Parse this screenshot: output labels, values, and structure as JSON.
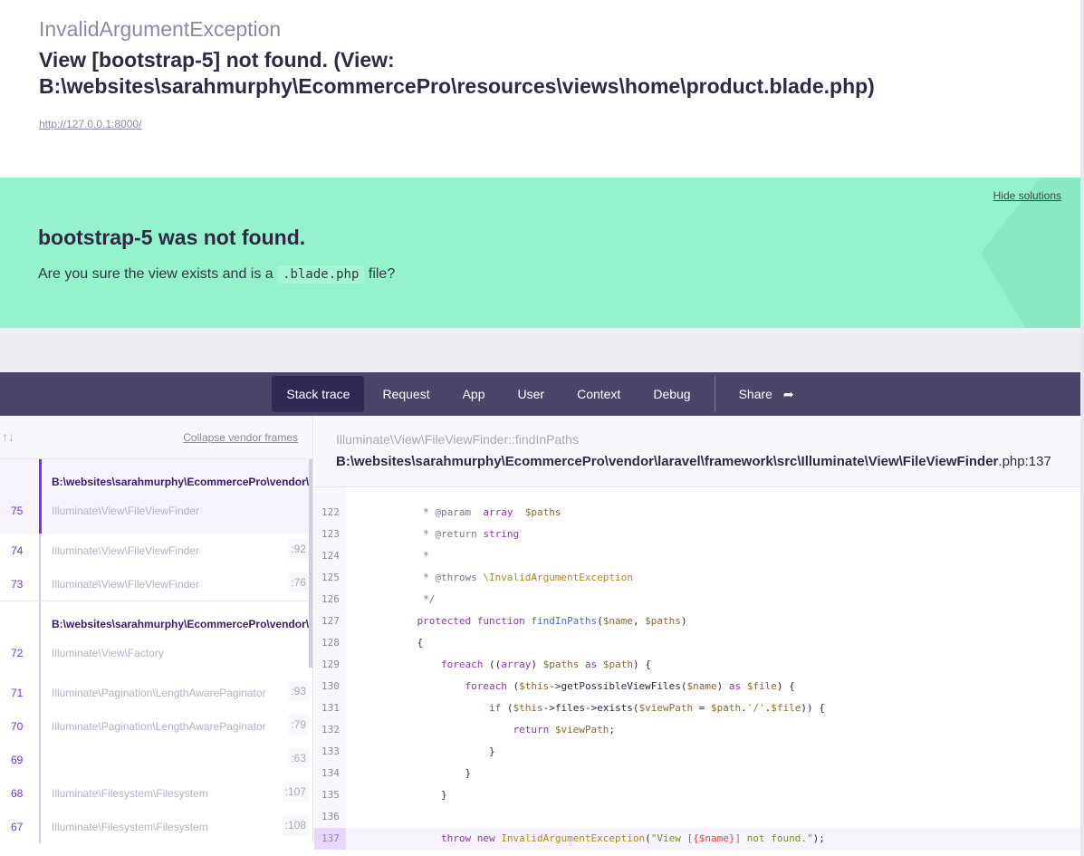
{
  "header": {
    "exception": "InvalidArgumentException",
    "message": "View [bootstrap-5] not found. (View: B:\\websites\\sarahmurphy\\EcommercePro\\resources\\views\\home\\product.blade.php)",
    "url": "http://127.0.0.1:8000/"
  },
  "solution": {
    "hide_label": "Hide solutions",
    "title": "bootstrap-5 was not found.",
    "text_before": "Are you sure the view exists and is a ",
    "code": ".blade.php",
    "text_after": " file?"
  },
  "nav": {
    "tabs": [
      "Stack trace",
      "Request",
      "App",
      "User",
      "Context",
      "Debug"
    ],
    "active": "Stack trace",
    "share": "Share"
  },
  "frames_panel": {
    "collapse_label": "Collapse vendor frames",
    "groups": [
      {
        "path": "B:\\websites\\sarahmurphy\\EcommercePro\\vendor\\laravel\\framework\\src\\Illuminate\\View\\FileViewFinder.php",
        "frames": [
          {
            "num": "75",
            "cls": "Illuminate\\View\\FileViewFinder",
            "line": "",
            "selected": true
          },
          {
            "num": "74",
            "cls": "Illuminate\\View\\FileViewFinder",
            "line": ":92"
          },
          {
            "num": "73",
            "cls": "Illuminate\\View\\FileViewFinder",
            "line": ":76"
          }
        ]
      },
      {
        "path": "B:\\websites\\sarahmurphy\\EcommercePro\\vendor\\laravel\\framework\\src\\Illuminate\\View\\Factory.php",
        "frames": [
          {
            "num": "72",
            "cls": "Illuminate\\View\\Factory",
            "line": ""
          },
          {
            "num": "71",
            "cls": "Illuminate\\Pagination\\LengthAwarePaginator",
            "line": ":93"
          },
          {
            "num": "70",
            "cls": "Illuminate\\Pagination\\LengthAwarePaginator",
            "line": ":79"
          },
          {
            "num": "69",
            "cls": "",
            "line": ":63"
          },
          {
            "num": "68",
            "cls": "Illuminate\\Filesystem\\Filesystem",
            "line": ":107"
          },
          {
            "num": "67",
            "cls": "Illuminate\\Filesystem\\Filesystem",
            "line": ":108"
          }
        ]
      }
    ]
  },
  "code_panel": {
    "function": "Illuminate\\View\\FileViewFinder::findInPaths",
    "file_path": "B:\\websites\\sarahmurphy\\EcommercePro\\vendor\\laravel\\framework\\src\\Illuminate\\View\\FileViewFinder",
    "file_suffix": ".php:137",
    "highlight_line": "137",
    "lines": [
      {
        "n": "122",
        "seg": [
          [
            "c",
            "     * @param  "
          ],
          [
            "k",
            "array"
          ],
          [
            "c",
            "  "
          ],
          [
            "v",
            "$paths"
          ]
        ]
      },
      {
        "n": "123",
        "seg": [
          [
            "c",
            "     * @return "
          ],
          [
            "k",
            "string"
          ]
        ]
      },
      {
        "n": "124",
        "seg": [
          [
            "c",
            "     *"
          ]
        ]
      },
      {
        "n": "125",
        "seg": [
          [
            "c",
            "     * @throws "
          ],
          [
            "ty",
            "\\InvalidArgumentException"
          ]
        ]
      },
      {
        "n": "126",
        "seg": [
          [
            "c",
            "     */"
          ]
        ]
      },
      {
        "n": "127",
        "seg": [
          [
            "k",
            "    protected function "
          ],
          [
            "f",
            "findInPaths"
          ],
          [
            "",
            "("
          ],
          [
            "v",
            "$name"
          ],
          [
            "",
            ", "
          ],
          [
            "v",
            "$paths"
          ],
          [
            "",
            ")"
          ]
        ]
      },
      {
        "n": "128",
        "seg": [
          [
            "",
            "    {"
          ]
        ]
      },
      {
        "n": "129",
        "seg": [
          [
            "k",
            "        foreach "
          ],
          [
            "",
            "(("
          ],
          [
            "k",
            "array"
          ],
          [
            "",
            ") "
          ],
          [
            "v",
            "$paths"
          ],
          [
            "k",
            " as "
          ],
          [
            "v",
            "$path"
          ],
          [
            "",
            ") {"
          ]
        ]
      },
      {
        "n": "130",
        "seg": [
          [
            "k",
            "            foreach "
          ],
          [
            "",
            "("
          ],
          [
            "v",
            "$this"
          ],
          [
            "",
            "->getPossibleViewFiles("
          ],
          [
            "v",
            "$name"
          ],
          [
            "",
            ")"
          ],
          [
            "k",
            " as "
          ],
          [
            "v",
            "$file"
          ],
          [
            "",
            ") {"
          ]
        ]
      },
      {
        "n": "131",
        "seg": [
          [
            "k",
            "                if "
          ],
          [
            "",
            "("
          ],
          [
            "v",
            "$this"
          ],
          [
            "",
            "->files->exists("
          ],
          [
            "v",
            "$viewPath"
          ],
          [
            "",
            " = "
          ],
          [
            "v",
            "$path"
          ],
          [
            "",
            "."
          ],
          [
            "s",
            "'/'"
          ],
          [
            "",
            "."
          ],
          [
            "v",
            "$file"
          ],
          [
            "",
            ")) {"
          ]
        ]
      },
      {
        "n": "132",
        "seg": [
          [
            "k",
            "                    return "
          ],
          [
            "v",
            "$viewPath"
          ],
          [
            "",
            ";"
          ]
        ]
      },
      {
        "n": "133",
        "seg": [
          [
            "",
            "                }"
          ]
        ]
      },
      {
        "n": "134",
        "seg": [
          [
            "",
            "            }"
          ]
        ]
      },
      {
        "n": "135",
        "seg": [
          [
            "",
            "        }"
          ]
        ]
      },
      {
        "n": "136",
        "seg": []
      },
      {
        "n": "137",
        "seg": [
          [
            "k",
            "        throw new "
          ],
          [
            "ty",
            "InvalidArgumentException"
          ],
          [
            "",
            "("
          ],
          [
            "s",
            "\"View ["
          ],
          [
            "r",
            "{$name}"
          ],
          [
            "s",
            "] not found.\""
          ],
          [
            "",
            ");"
          ]
        ]
      }
    ]
  }
}
